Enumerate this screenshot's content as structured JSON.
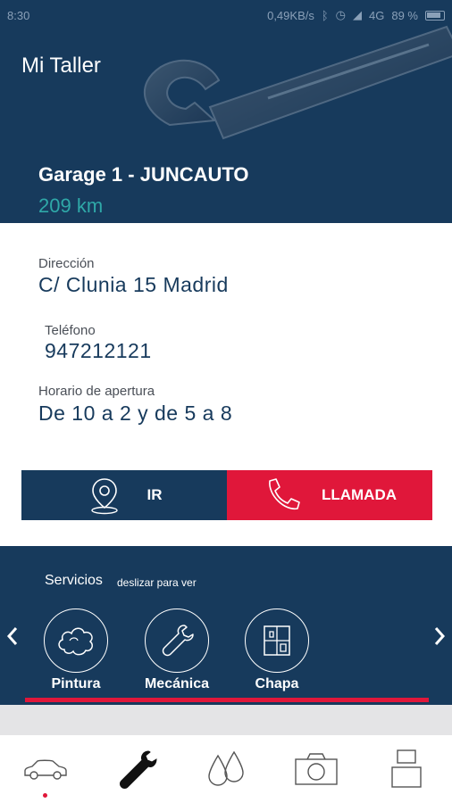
{
  "status_bar": {
    "time": "8:30",
    "network_speed": "0,49KB/s",
    "network_type": "4G",
    "battery": "89 %"
  },
  "header": {
    "title": "Mi Taller",
    "garage_name": "Garage 1 - JUNCAUTO",
    "distance": "209 km"
  },
  "details": {
    "address_label": "Dirección",
    "address": "C/ Clunia 15 Madrid",
    "phone_label": "Teléfono",
    "phone": "947212121",
    "hours_label": "Horario de apertura",
    "hours": "De 10 a 2 y de 5 a 8"
  },
  "actions": {
    "go_label": "IR",
    "call_label": "LLAMADA"
  },
  "services": {
    "title": "Servicios",
    "hint": "deslizar para ver",
    "items": [
      {
        "label": "Pintura",
        "icon": "paint-cloud-icon"
      },
      {
        "label": "Mecánica",
        "icon": "wrench-icon"
      },
      {
        "label": "Chapa",
        "icon": "car-panel-icon"
      }
    ]
  },
  "bottom_nav": {
    "items": [
      {
        "icon": "car-icon",
        "active": true
      },
      {
        "icon": "wrench-icon",
        "active": false
      },
      {
        "icon": "drops-icon",
        "active": false
      },
      {
        "icon": "camera-icon",
        "active": false
      },
      {
        "icon": "profile-icon",
        "active": false
      }
    ]
  },
  "colors": {
    "primary_navy": "#173a5c",
    "accent_red": "#e0173a",
    "distance_teal": "#2fa8a8"
  }
}
